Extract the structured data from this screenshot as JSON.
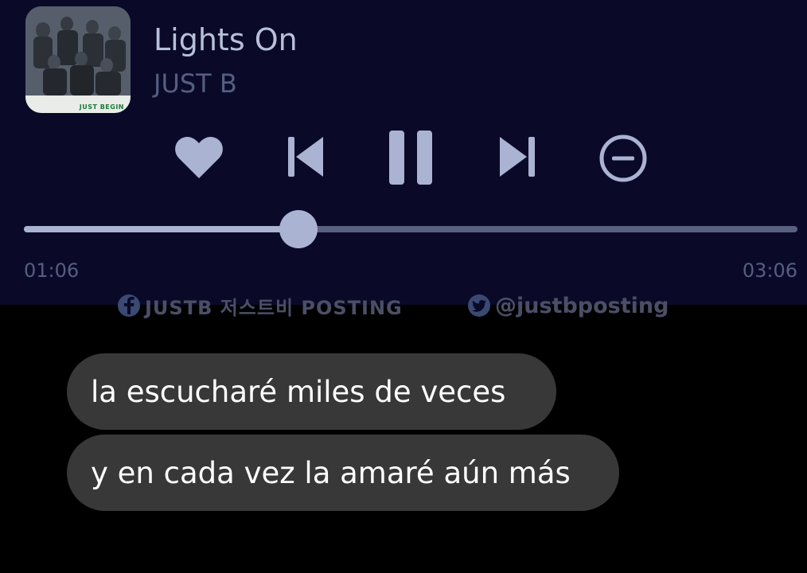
{
  "now_playing": {
    "title": "Lights On",
    "artist": "JUST B",
    "album_label": "JUST BEGIN",
    "elapsed": "01:06",
    "duration": "03:06",
    "progress_fraction": 0.355,
    "state": "playing"
  },
  "controls": {
    "like_icon": "heart-icon",
    "previous_icon": "skip-previous-icon",
    "pause_icon": "pause-icon",
    "next_icon": "skip-next-icon",
    "remove_icon": "minus-circle-icon"
  },
  "watermark": {
    "left_icon": "facebook-icon",
    "left_text": "JUSTB 저스트비 POSTING",
    "right_icon": "twitter-icon",
    "right_text": "@justbposting"
  },
  "messages": [
    {
      "text": "la escucharé miles de veces"
    },
    {
      "text": "y en cada vez la amaré aún más"
    }
  ],
  "colors": {
    "player_background": "#0a0a28",
    "accent": "#aab3d2",
    "track": "#5a6080",
    "muted_text": "#555e80",
    "bubble": "#383838",
    "page_background": "#000000"
  }
}
